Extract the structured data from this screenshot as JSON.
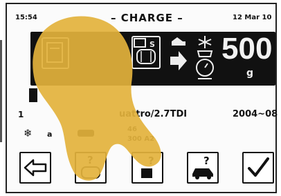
{
  "status_bar": {
    "time": "15:54",
    "title": "– CHARGE –",
    "date": "12 Mar 10"
  },
  "panel": {
    "amount": "500",
    "unit": "g",
    "service_badge": "S"
  },
  "vehicle": {
    "number_fragment": "1",
    "model": "uattro/2.7TDI",
    "year": "2004~08",
    "code_line_1": "46",
    "code_line_2": "300 A2",
    "fragment": "a"
  },
  "buttons": {
    "back": "back-arrow-icon",
    "oil_help_q": "?",
    "component_help_q": "?",
    "vehicle_help_q": "?",
    "confirm": "check-icon"
  },
  "colors": {
    "panel": "#111111",
    "finger": "#e3b23c",
    "screen": "#fbfbfb"
  }
}
